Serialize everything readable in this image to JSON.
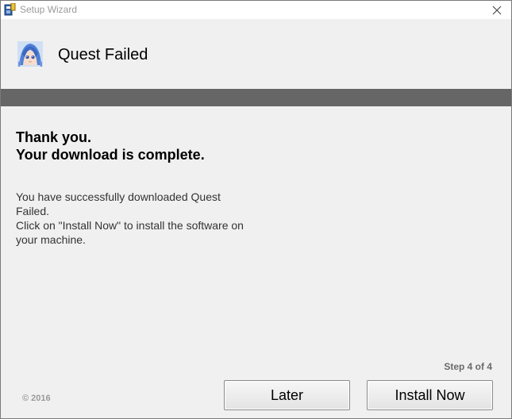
{
  "window": {
    "title": "Setup Wizard",
    "icons": [
      "installer-icon",
      "close-icon"
    ]
  },
  "header": {
    "product_name": "Quest Failed",
    "logo": "anime-avatar-logo"
  },
  "content": {
    "headline_line1": "Thank you.",
    "headline_line2": "Your download is complete.",
    "body_line1": "You have successfully downloaded Quest Failed.",
    "body_line2": "Click on \"Install Now\" to install the software on your machine."
  },
  "footer": {
    "step_text": "Step 4 of 4",
    "copyright": "© 2016",
    "later_label": "Later",
    "install_label": "Install Now"
  },
  "colors": {
    "band": "#666666",
    "background": "#f0f0f0"
  }
}
